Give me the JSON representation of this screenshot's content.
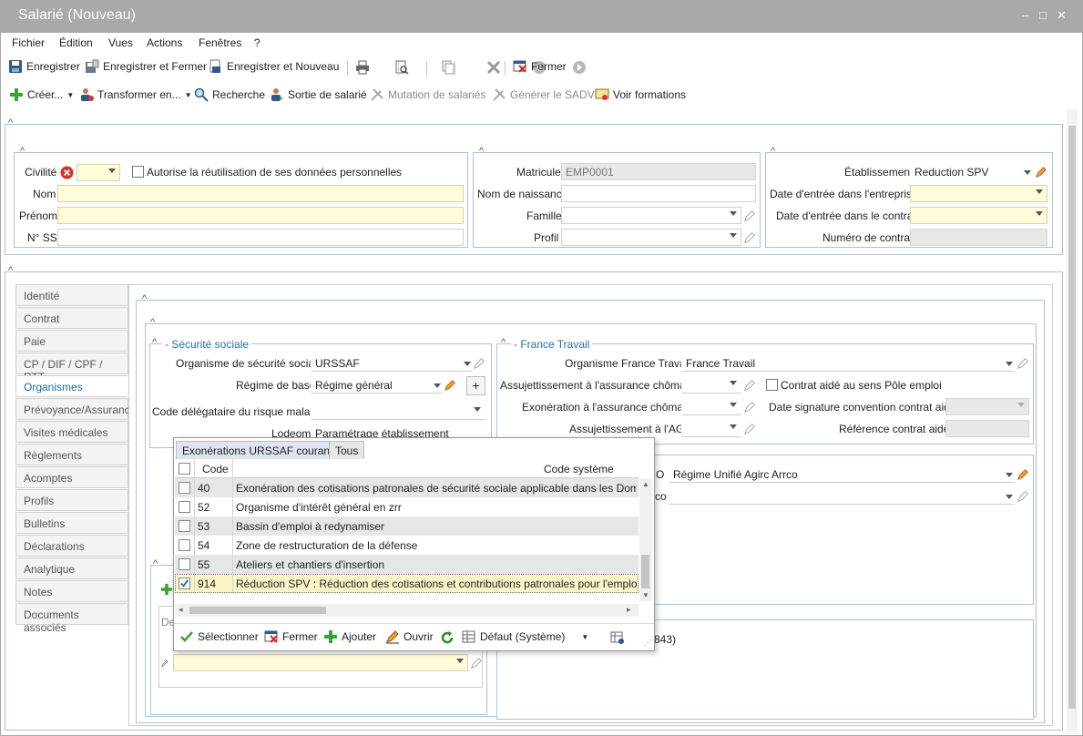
{
  "window": {
    "title": "Salarié (Nouveau)",
    "min": "–",
    "max": "□",
    "close": "✕"
  },
  "menu": [
    "Fichier",
    "Édition",
    "Vues",
    "Actions",
    "Fenêtres",
    "?"
  ],
  "toolbar1": {
    "save": "Enregistrer",
    "save_close": "Enregistrer et Fermer",
    "save_new": "Enregistrer et Nouveau",
    "close": "Fermer"
  },
  "toolbar2": {
    "create": "Créer...",
    "transform": "Transformer en...",
    "search": "Recherche",
    "exit": "Sortie de salarié",
    "mutation": "Mutation de salariés",
    "sadv": "Générer le SADV",
    "training": "Voir formations"
  },
  "identity": {
    "civilite_label": "Civilité",
    "reuse_label": "Autorise la réutilisation de ses données personnelles",
    "nom_label": "Nom",
    "prenom_label": "Prénom",
    "nss_label": "N° SS"
  },
  "matricule": {
    "matricule_label": "Matricule",
    "matricule_value": "EMP0001",
    "naissance_label": "Nom de naissance",
    "famille_label": "Famille",
    "profil_label": "Profil"
  },
  "etab": {
    "etab_label": "Établissement",
    "etab_value": "Reduction SPV",
    "entree_entreprise_label": "Date d'entrée dans l'entreprise",
    "entree_contrat_label": "Date d'entrée dans le contrat",
    "numero_contrat_label": "Numéro de contrat"
  },
  "tabs": [
    "Identité",
    "Contrat",
    "Paie",
    "CP / DIF / CPF / RTT",
    "Organismes",
    "Prévoyance/Assurance",
    "Visites médicales",
    "Règlements",
    "Acomptes",
    "Profils",
    "Bulletins",
    "Déclarations",
    "Analytique",
    "Notes",
    "Documents associés"
  ],
  "secu": {
    "title": "- Sécurité sociale",
    "org_label": "Organisme de sécurité sociale",
    "org_value": "URSSAF",
    "regime_label": "Régime de base",
    "regime_value": "Régime général",
    "delegataire_label": "Code délégataire du risque maladie",
    "lodeom_label": "Lodeom",
    "lodeom_value": "Paramétrage établissement"
  },
  "ft": {
    "title": "- France Travail",
    "org_label": "Organisme France Travail",
    "org_value": "France Travail",
    "assuj_label": "Assujettissement à l'assurance chômage",
    "exo_label": "Exonération à l'assurance chômage",
    "ags_label": "Assujettissement à l'AGS",
    "aide_label": "Contrat aidé au sens Pôle emploi",
    "date_sig_label": "Date signature convention contrat aidé",
    "ref_label": "Référence contrat aidé"
  },
  "retraite": {
    "regime_suffix": "O",
    "regime_value": "Régime Unifié Agirc Arrco",
    "row2_suffix": "co"
  },
  "misc": {
    "partial_count": "843)",
    "partial_de": "De"
  },
  "popup": {
    "tab1": "Exonérations URSSAF courantes",
    "tab2": "Tous",
    "col_code": "Code",
    "col_system": "Code système",
    "rows": [
      {
        "code": "40",
        "label": "Exonération des cotisations patronales de sécurité sociale applicable dans les Dom",
        "checked": false
      },
      {
        "code": "52",
        "label": "Organisme d'intérêt général en zrr",
        "checked": false
      },
      {
        "code": "53",
        "label": "Bassin d'emploi à redynamiser",
        "checked": false
      },
      {
        "code": "54",
        "label": "Zone de restructuration de la défense",
        "checked": false
      },
      {
        "code": "55",
        "label": "Ateliers et chantiers d'insertion",
        "checked": false
      },
      {
        "code": "914",
        "label": "Réduction SPV : Réduction des cotisations et contributions patronales pour l'emploi d'un salarié",
        "checked": true
      }
    ],
    "select": "Sélectionner",
    "close": "Fermer",
    "add": "Ajouter",
    "open": "Ouvrir",
    "view": "Défaut (Système)"
  },
  "colors": {
    "accent": "#1e6aa8",
    "required": "#fefcd9",
    "title_bar": "#a9a9a9",
    "group_border": "#a9c2d9"
  }
}
